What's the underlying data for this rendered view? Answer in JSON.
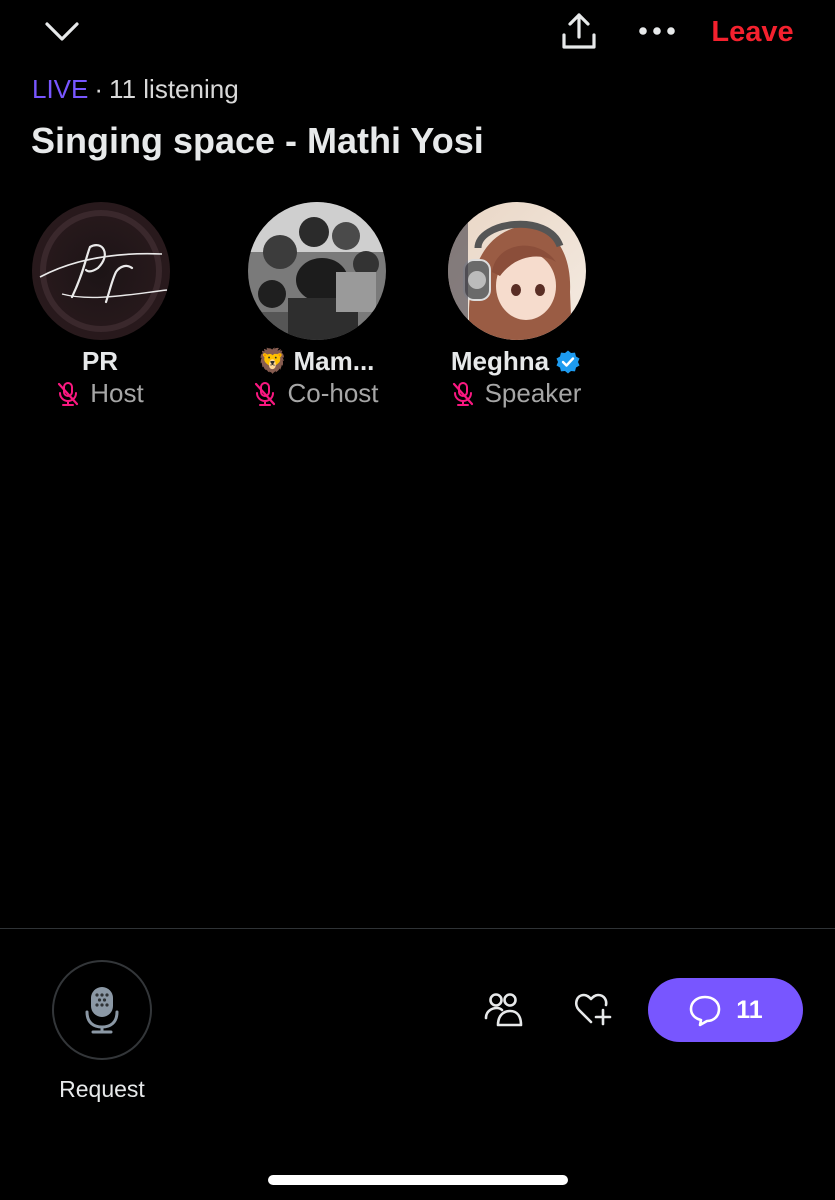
{
  "header": {
    "leave_label": "Leave",
    "collapse_icon": "chevron-down-icon",
    "share_icon": "share-icon",
    "more_icon": "more-icon"
  },
  "space": {
    "live_label": "LIVE",
    "separator": "·",
    "listening": "11 listening",
    "title": "Singing space - Mathi Yosi"
  },
  "participants": [
    {
      "name": "PR",
      "prefix_emoji": "",
      "verified": false,
      "role": "Host"
    },
    {
      "name": "Mam...",
      "prefix_emoji": "🦁",
      "verified": false,
      "role": "Co-host"
    },
    {
      "name": "Meghna",
      "prefix_emoji": "",
      "verified": true,
      "role": "Speaker"
    }
  ],
  "footer": {
    "request_label": "Request",
    "comments_count": "11"
  },
  "colors": {
    "accent": "#7856ff",
    "leave": "#f4212e",
    "muted_mic": "#f91880",
    "verified": "#1d9bf0"
  }
}
